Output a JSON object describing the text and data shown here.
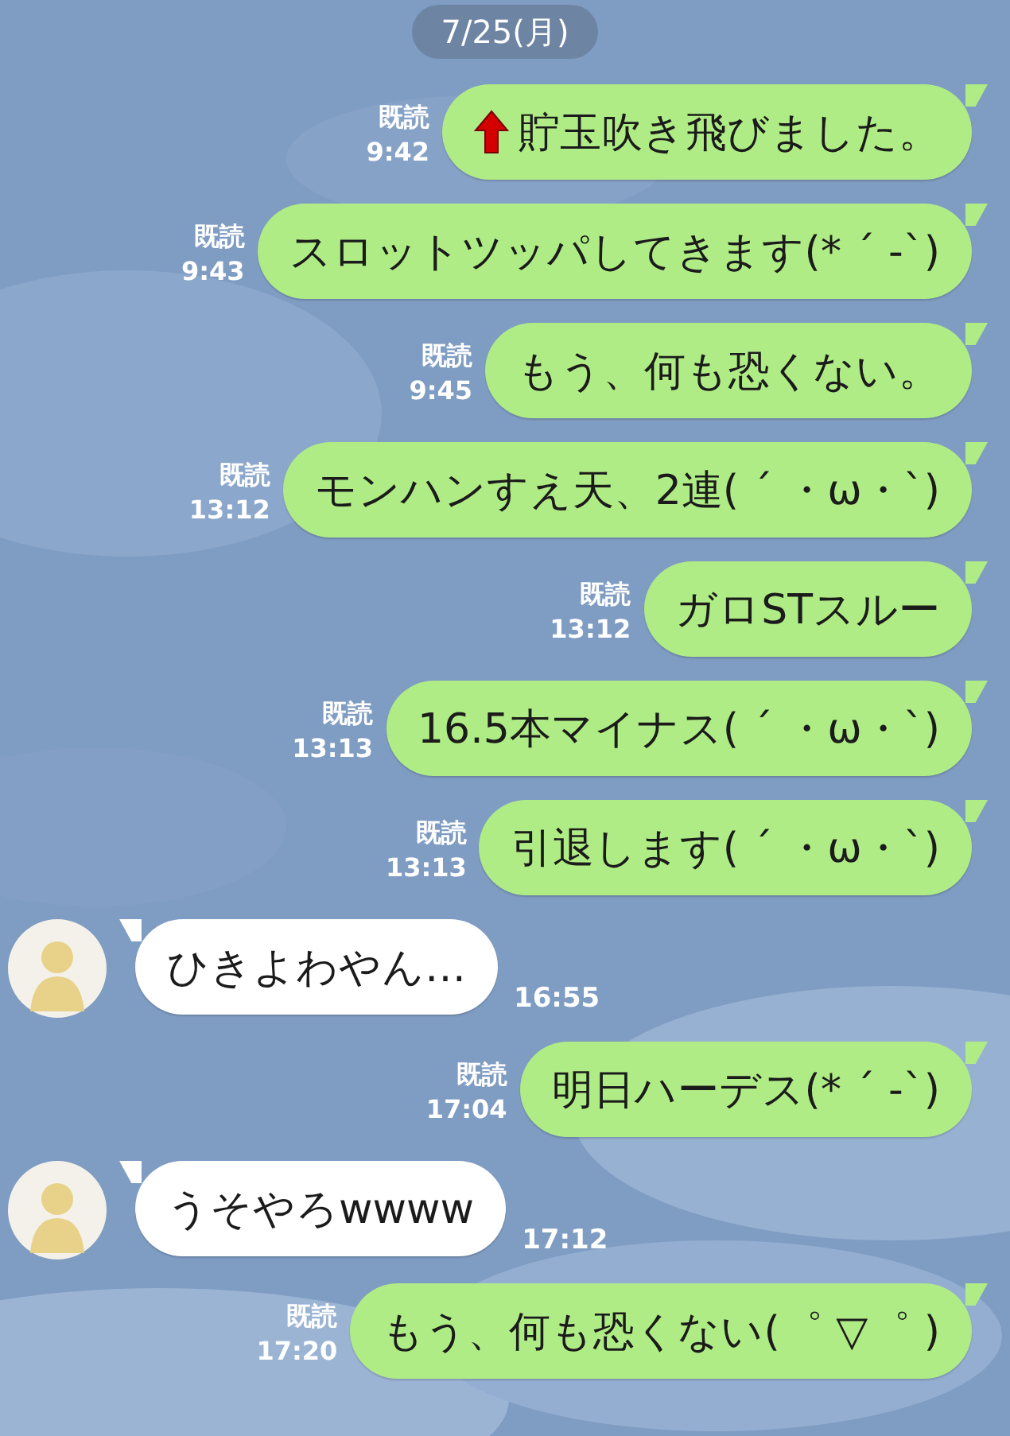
{
  "date_label": "7/25(月)",
  "messages": [
    {
      "kind": "sent",
      "icon": true,
      "text": "貯玉吹き飛びました。",
      "read": "既読",
      "time": "9:42"
    },
    {
      "kind": "sent",
      "text": "スロットツッパしてきます(* ´ -`)",
      "read": "既読",
      "time": "9:43"
    },
    {
      "kind": "sent",
      "text": "もう、何も恐くない。",
      "read": "既読",
      "time": "9:45"
    },
    {
      "kind": "sent",
      "text": "モンハンすえ天、2連( ´ ・ω・`)",
      "read": "既読",
      "time": "13:12"
    },
    {
      "kind": "sent",
      "text": "ガロSTスルー",
      "read": "既読",
      "time": "13:12"
    },
    {
      "kind": "sent",
      "text": "16.5本マイナス( ´ ・ω・`)",
      "read": "既読",
      "time": "13:13"
    },
    {
      "kind": "sent",
      "text": "引退します( ´ ・ω・`)",
      "read": "既読",
      "time": "13:13"
    },
    {
      "kind": "received",
      "text": "ひきよわやん…",
      "time": "16:55"
    },
    {
      "kind": "sent",
      "text": "明日ハーデス(* ´ -`)",
      "read": "既読",
      "time": "17:04"
    },
    {
      "kind": "received",
      "text": "うそやろwwww",
      "time": "17:12"
    },
    {
      "kind": "sent",
      "text": "もう、何も恐くない(゜ ▽゜ )",
      "read": "既読",
      "time": "17:20"
    }
  ]
}
